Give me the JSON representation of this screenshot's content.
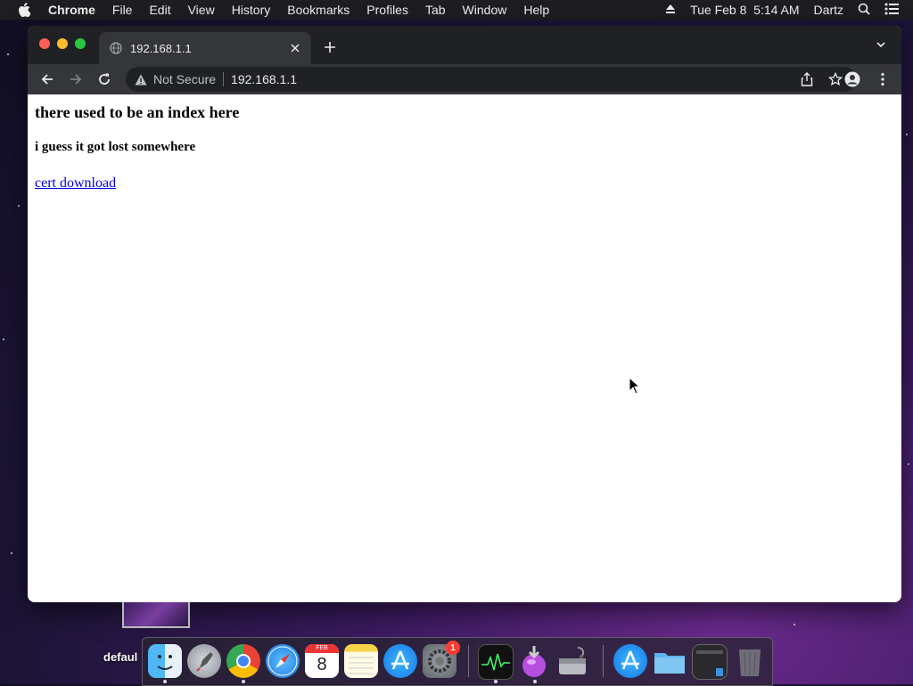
{
  "menubar": {
    "app_name": "Chrome",
    "items": [
      "File",
      "Edit",
      "View",
      "History",
      "Bookmarks",
      "Profiles",
      "Tab",
      "Window",
      "Help"
    ],
    "datetime": "Tue Feb 8  5:14 AM",
    "user": "Dartz",
    "icons": [
      "apple-icon",
      "eject-icon",
      "spotlight-search-icon",
      "control-center-icon"
    ]
  },
  "browser": {
    "tab_title": "192.168.1.1",
    "security_label": "Not Secure",
    "url": "192.168.1.1"
  },
  "page": {
    "heading": "there used to be an index here",
    "subheading": "i guess it got lost somewhere",
    "link_text": "cert download"
  },
  "desktop": {
    "label": "defaul"
  },
  "dock": {
    "apps": [
      "finder",
      "launchpad",
      "chrome",
      "safari",
      "calendar",
      "notes",
      "app-store",
      "system-preferences",
      "activity-monitor",
      "installer",
      "disk-utility",
      "app-store-alt",
      "folder",
      "finder-window",
      "trash"
    ],
    "calendar_day": "8",
    "calendar_month": "FEB",
    "system_preferences_badge": "1"
  },
  "colors": {
    "link": "#0000ee",
    "tabstrip": "#202124",
    "toolbar": "#35363a"
  }
}
